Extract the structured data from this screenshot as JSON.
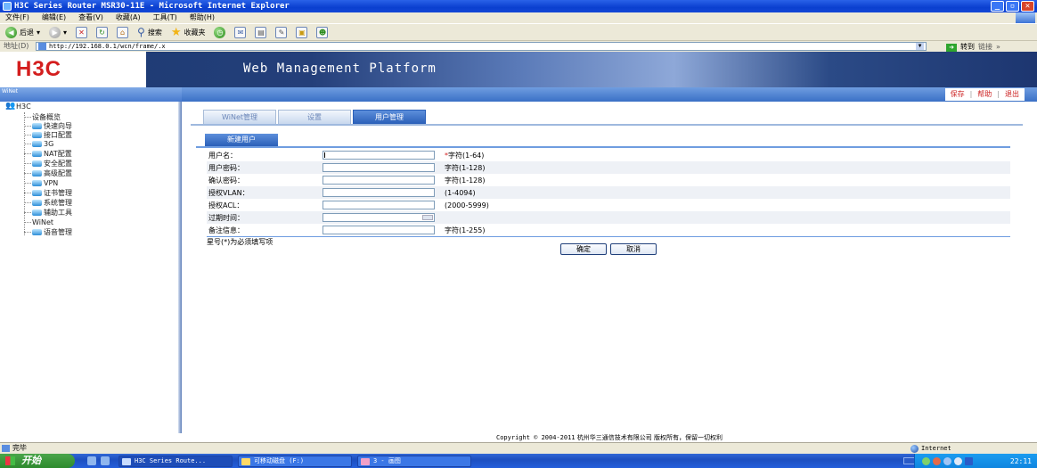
{
  "window": {
    "title": "H3C Series Router MSR30-11E - Microsoft Internet Explorer"
  },
  "menu": [
    "文件(F)",
    "编辑(E)",
    "查看(V)",
    "收藏(A)",
    "工具(T)",
    "帮助(H)"
  ],
  "toolbar": {
    "back": "后退",
    "search": "搜索",
    "favorites": "收藏夹"
  },
  "address": {
    "label": "地址(D)",
    "url": "http://192.168.0.1/wcn/frame/.x",
    "go": "转到",
    "links": "链接"
  },
  "banner": {
    "logo": "H3C",
    "title": "Web Management Platform"
  },
  "sidebar": {
    "header": "WiNet",
    "root": "H3C",
    "items": [
      "设备概览",
      "快速向导",
      "接口配置",
      "3G",
      "NAT配置",
      "安全配置",
      "高级配置",
      "VPN",
      "证书管理",
      "系统管理",
      "辅助工具",
      "WiNet",
      "语音管理"
    ]
  },
  "toplinks": {
    "save": "保存",
    "help": "帮助",
    "logout": "退出"
  },
  "tabs": [
    "WiNet管理",
    "设置",
    "用户管理"
  ],
  "subtab": "新建用户",
  "form": {
    "rows": [
      {
        "label": "用户名：",
        "hint_req": "*",
        "hint": "字符(1-64)"
      },
      {
        "label": "用户密码：",
        "hint_req": "",
        "hint": "字符(1-128)"
      },
      {
        "label": "确认密码：",
        "hint_req": "",
        "hint": "字符(1-128)"
      },
      {
        "label": "授权VLAN：",
        "hint_req": "",
        "hint": "(1-4094)"
      },
      {
        "label": "授权ACL：",
        "hint_req": "",
        "hint": "(2000-5999)"
      },
      {
        "label": "过期时间：",
        "hint_req": "",
        "hint": ""
      },
      {
        "label": "备注信息：",
        "hint_req": "",
        "hint": "字符(1-255)"
      }
    ],
    "note": "星号(*)为必须填写项",
    "ok": "确定",
    "cancel": "取消"
  },
  "footer": {
    "copyright": "Copyright © 2004-2011",
    "company": "杭州华三通信技术有限公司 版权所有，保留一切权利"
  },
  "status": {
    "text": "完毕",
    "zone": "Internet"
  },
  "taskbar": {
    "start": "开始",
    "tasks": [
      "H3C Series Route...",
      "可移动磁盘 (F:)",
      "3 - 画图"
    ],
    "clock": "22:11"
  },
  "colors": {
    "accent": "#2a5fb8",
    "logo": "#d41e1e",
    "required": "#d41e1e"
  }
}
